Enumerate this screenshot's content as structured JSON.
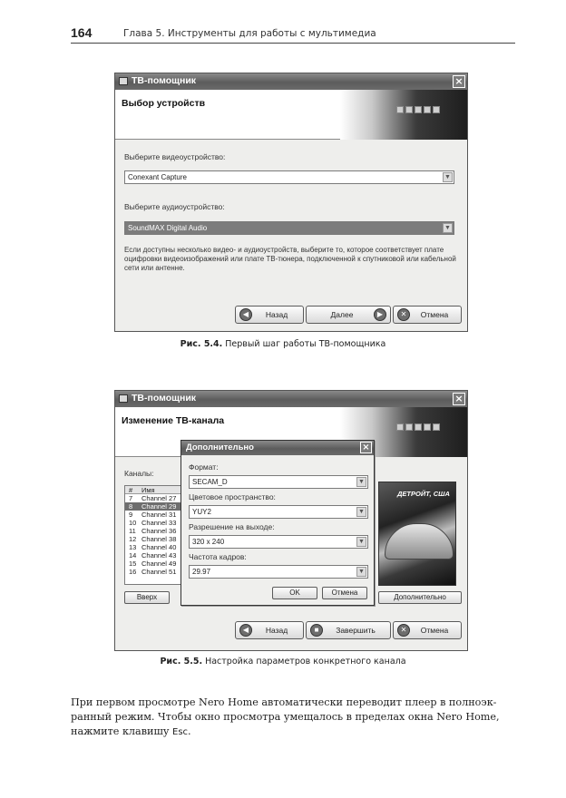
{
  "header": {
    "page_number": "164",
    "chapter": "Глава 5. Инструменты для работы с мультимедиа"
  },
  "figure1": {
    "window_title": "ТВ-помощник",
    "banner_title": "Выбор устройств",
    "video_label": "Выберите видеоустройство:",
    "video_value": "Conexant Capture",
    "audio_label": "Выберите аудиоустройство:",
    "audio_value": "SoundMAX Digital Audio",
    "help_line1": "Если доступны несколько видео- и аудиоустройств, выберите то, которое соответствует плате",
    "help_line2": "оцифровки видеоизображений или плате ТВ-тюнера, подключенной к спутниковой или кабельной",
    "help_line3": "сети или антенне.",
    "btn_back": "Назад",
    "btn_next": "Далее",
    "btn_cancel": "Отмена",
    "caption_num": "Рис. 5.4.",
    "caption_text": " Первый шаг работы ТВ-помощника"
  },
  "figure2": {
    "window_title": "ТВ-помощник",
    "banner_title": "Изменение ТВ-канала",
    "channels_label": "Каналы:",
    "list_header": {
      "num": "#",
      "name": "Имя"
    },
    "channels": [
      {
        "num": "7",
        "name": "Channel 27"
      },
      {
        "num": "8",
        "name": "Channel 29"
      },
      {
        "num": "9",
        "name": "Channel 31"
      },
      {
        "num": "10",
        "name": "Channel 33"
      },
      {
        "num": "11",
        "name": "Channel 36"
      },
      {
        "num": "12",
        "name": "Channel 38"
      },
      {
        "num": "13",
        "name": "Channel 40"
      },
      {
        "num": "14",
        "name": "Channel 43"
      },
      {
        "num": "15",
        "name": "Channel 49"
      },
      {
        "num": "16",
        "name": "Channel 51"
      }
    ],
    "selected_channel": "8",
    "btn_up": "Вверх",
    "btn_more": "Дополнительно",
    "preview_caption": "ДЕТРОЙТ, США",
    "btn_back": "Назад",
    "btn_finish": "Завершить",
    "btn_cancel": "Отмена",
    "dialog": {
      "title": "Дополнительно",
      "format_label": "Формат:",
      "format_value": "SECAM_D",
      "color_label": "Цветовое пространство:",
      "color_value": "YUY2",
      "resolution_label": "Разрешение на выходе:",
      "resolution_value": "320 x 240",
      "fps_label": "Частота кадров:",
      "fps_value": "29.97",
      "btn_ok": "OK",
      "btn_cancel": "Отмена"
    },
    "caption_num": "Рис. 5.5.",
    "caption_text": " Настройка параметров конкретного канала"
  },
  "body": {
    "line1": "При первом просмотре Nero Home автоматически переводит плеер в полноэк-",
    "line2": "ранный режим. Чтобы окно просмотра умещалось в пределах окна Nero Home,",
    "line3_prefix": "нажмите клавишу ",
    "line3_key": "Esc",
    "line3_suffix": "."
  }
}
